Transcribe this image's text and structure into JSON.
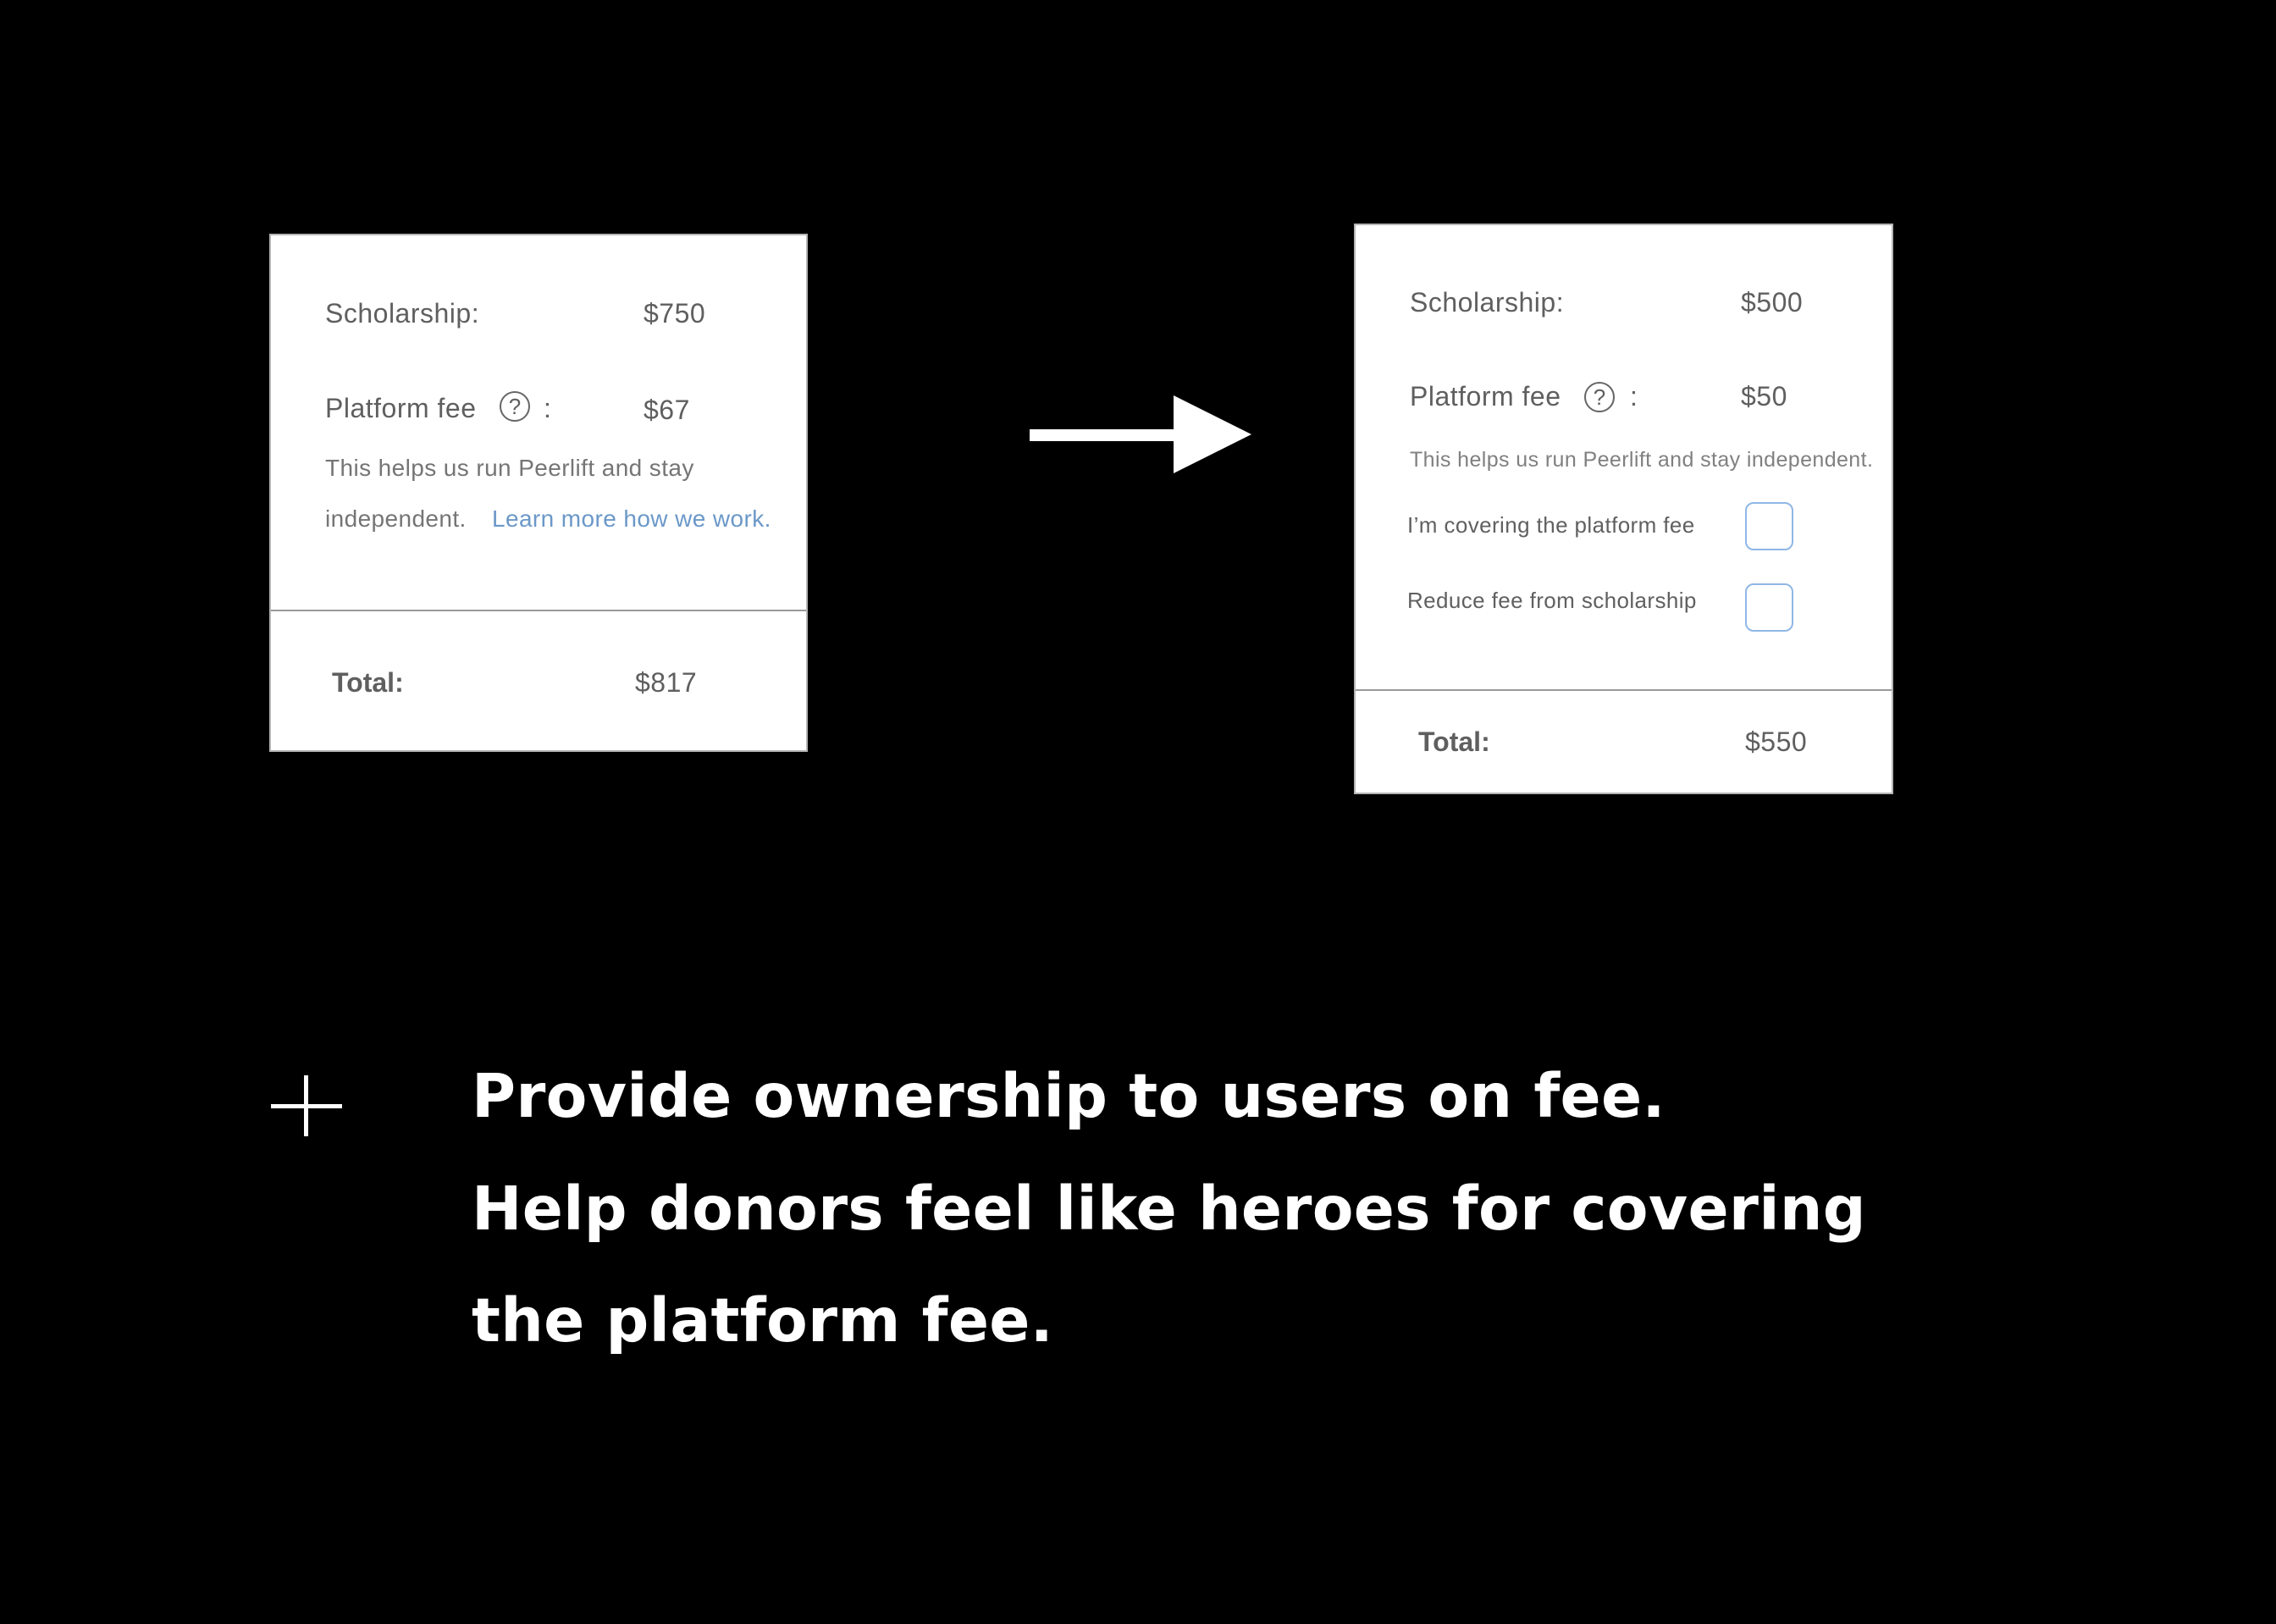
{
  "before_card": {
    "scholarship_label": "Scholarship:",
    "scholarship_value": "$750",
    "fee_label": "Platform fee",
    "fee_help_glyph": "?",
    "fee_colon": ":",
    "fee_value": "$67",
    "note_line1": "This helps us run Peerlift and stay",
    "note_line2": "independent.",
    "learn_more_link": "Learn more how we work.",
    "total_label": "Total:",
    "total_value": "$817"
  },
  "after_card": {
    "scholarship_label": "Scholarship:",
    "scholarship_value": "$500",
    "fee_label": "Platform fee",
    "fee_help_glyph": "?",
    "fee_colon": ":",
    "fee_value": "$50",
    "note": "This helps us run Peerlift and stay independent.",
    "option_cover_label": "I’m covering the platform fee",
    "option_reduce_label": "Reduce fee from scholarship",
    "total_label": "Total:",
    "total_value": "$550"
  },
  "icons": {
    "arrow": "right-arrow-icon",
    "plus": "plus-icon",
    "help": "question-circle-icon"
  },
  "colors": {
    "background": "#000000",
    "link": "#6b98c8",
    "checkbox_border": "#8fb8e6"
  },
  "summary": {
    "line1": "Provide ownership to users on fee.",
    "line2": "Help donors feel like heroes for covering",
    "line3": "the platform fee."
  }
}
